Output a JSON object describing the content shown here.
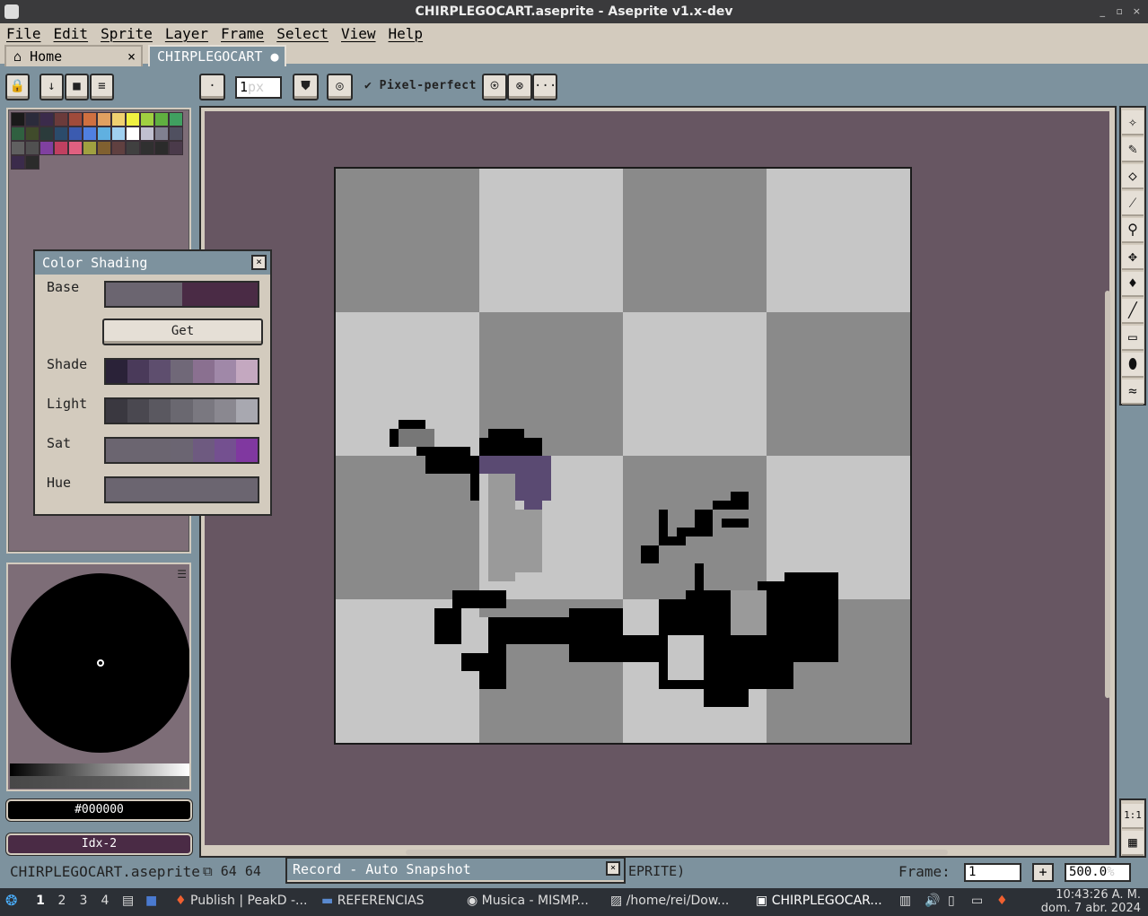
{
  "window": {
    "title": "CHIRPLEGOCART.aseprite - Aseprite v1.x-dev",
    "controls": [
      "_",
      "▫",
      "×"
    ]
  },
  "menu": [
    "File",
    "Edit",
    "Sprite",
    "Layer",
    "Frame",
    "Select",
    "View",
    "Help"
  ],
  "tabs": {
    "home_label": "Home",
    "home_close": "×",
    "doc_label": "CHIRPLEGOCART"
  },
  "toolbar": {
    "brush_size": "1",
    "brush_size_unit": "px",
    "pixel_perfect_label": "Pixel-perfect",
    "more_label": "···"
  },
  "palette": {
    "colors": [
      "#1a1a1a",
      "#2b2b3b",
      "#3b2b4b",
      "#6b3b3b",
      "#a04b3b",
      "#d07040",
      "#e0a060",
      "#f0d070",
      "#f0f040",
      "#a0d040",
      "#60b040",
      "#40a060",
      "#306040",
      "#404b2b",
      "#2b3b3b",
      "#2b4b6b",
      "#3b5bb0",
      "#5080e0",
      "#60b0e0",
      "#a0d0f0",
      "#ffffff",
      "#c0c0d0",
      "#808090",
      "#505060",
      "#606060",
      "#505050",
      "#8040a0",
      "#c04060",
      "#e06080",
      "#a0a040",
      "#806030",
      "#604040",
      "#404040",
      "#303030",
      "#2b2b2b",
      "#4a3a4a",
      "#3b2b4b",
      "#2b2b2b"
    ]
  },
  "color_bar": {
    "fg": "#000000",
    "bg": "Idx-2",
    "bg_color": "#4a2b45"
  },
  "shading": {
    "title": "Color Shading",
    "close": "×",
    "base_label": "Base",
    "base_colors": [
      "#6b6570",
      "#4a2b45"
    ],
    "get_label": "Get",
    "shade_label": "Shade",
    "shade_colors": [
      "#2a2238",
      "#4a3a5a",
      "#5e4e6e",
      "#706878",
      "#8a7090",
      "#a088a8",
      "#c4a8c0"
    ],
    "light_label": "Light",
    "light_colors": [
      "#3a3840",
      "#4a4850",
      "#5a5860",
      "#6a6870",
      "#7a7880",
      "#8a8890",
      "#a8a8b0"
    ],
    "sat_label": "Sat",
    "sat_colors": [
      "#6b6570",
      "#6b6570",
      "#6b6570",
      "#6b6572",
      "#6e5a80",
      "#745090",
      "#8038a0"
    ],
    "hue_label": "Hue",
    "hue_colors": [
      "#6b6570",
      "#6b6570",
      "#6b6570",
      "#6b6570",
      "#6b6570",
      "#6b6570",
      "#6b6570"
    ]
  },
  "canvas": {
    "checker_light": "#c6c6c6",
    "checker_dark": "#8a8a8a",
    "background": "#675662"
  },
  "tools": [
    "magic-wand",
    "pencil",
    "eraser",
    "eyedropper",
    "zoom",
    "move",
    "paint-bucket",
    "line",
    "rectangle",
    "contour",
    "blur"
  ],
  "tool_glyphs": [
    "✧",
    "✎",
    "◇",
    "⁄",
    "⚲",
    "✥",
    "♦",
    "╱",
    "▭",
    "⬮",
    "≈"
  ],
  "tools_bottom": [
    "1:1",
    "▦"
  ],
  "status": {
    "file": "CHIRPLEGOCART.aseprite",
    "size": "64 64",
    "suffix": "EPRITE)",
    "frame_label": "Frame:",
    "frame_value": "1",
    "add_frame": "+",
    "zoom": "500.0",
    "zoom_unit": "%"
  },
  "record": {
    "title": "Record - Auto Snapshot",
    "close": "×"
  },
  "taskbar": {
    "workspaces": [
      "1",
      "2",
      "3",
      "4"
    ],
    "items": [
      "Publish | PeakD -...",
      "REFERENCIAS",
      "Musica - MISMP...",
      "/home/rei/Dow...",
      "CHIRPLEGOCAR..."
    ],
    "clock_time": "10:43:26 A. M.",
    "clock_date": "dom. 7 abr. 2024"
  }
}
